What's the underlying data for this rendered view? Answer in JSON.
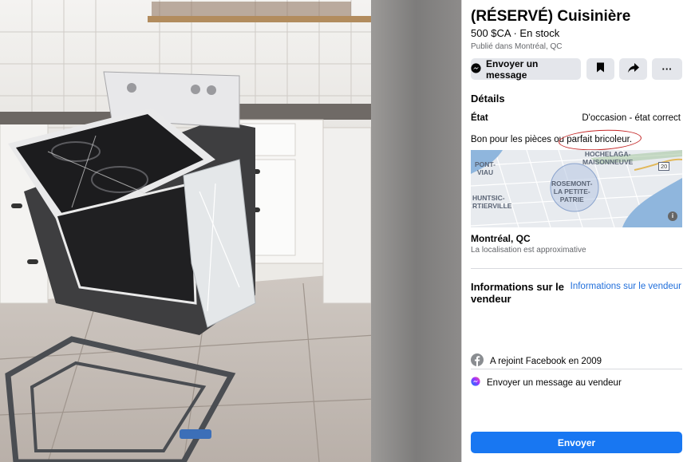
{
  "listing": {
    "title": "(RÉSERVÉ) Cuisinière",
    "price": "500 $CA · En stock",
    "posted": "Publié dans Montréal, QC"
  },
  "actions": {
    "message_label": "Envoyer un message",
    "save_icon": "bookmark-icon",
    "share_icon": "share-icon",
    "more_label": "···"
  },
  "details": {
    "heading": "Détails",
    "condition_label": "État",
    "condition_value": "D'occasion - état correct",
    "description_prefix": "Bon pour les pièces ou ",
    "description_highlight": "parfait bricoleur."
  },
  "map": {
    "labels": [
      "PONT-",
      "VIAU",
      "HOCHELAGA-",
      "MAISONNEUVE",
      "ROSEMONT-",
      "LA PETITE-",
      "PATRIE",
      "HUNTSIC-",
      "RTIERVILLE"
    ],
    "road_number": "20",
    "info_label": "i"
  },
  "location": {
    "name": "Montréal, QC",
    "note": "La localisation est approximative"
  },
  "seller": {
    "heading": "Informations sur le vendeur",
    "link": "Informations sur le vendeur",
    "joined": "A rejoint Facebook en 2009",
    "send_message": "Envoyer un message au vendeur"
  },
  "send": {
    "label": "Envoyer"
  },
  "colors": {
    "accent": "#1877f2",
    "link": "#216fdb",
    "button_bg": "#e4e6eb",
    "annotation": "#c42828"
  }
}
